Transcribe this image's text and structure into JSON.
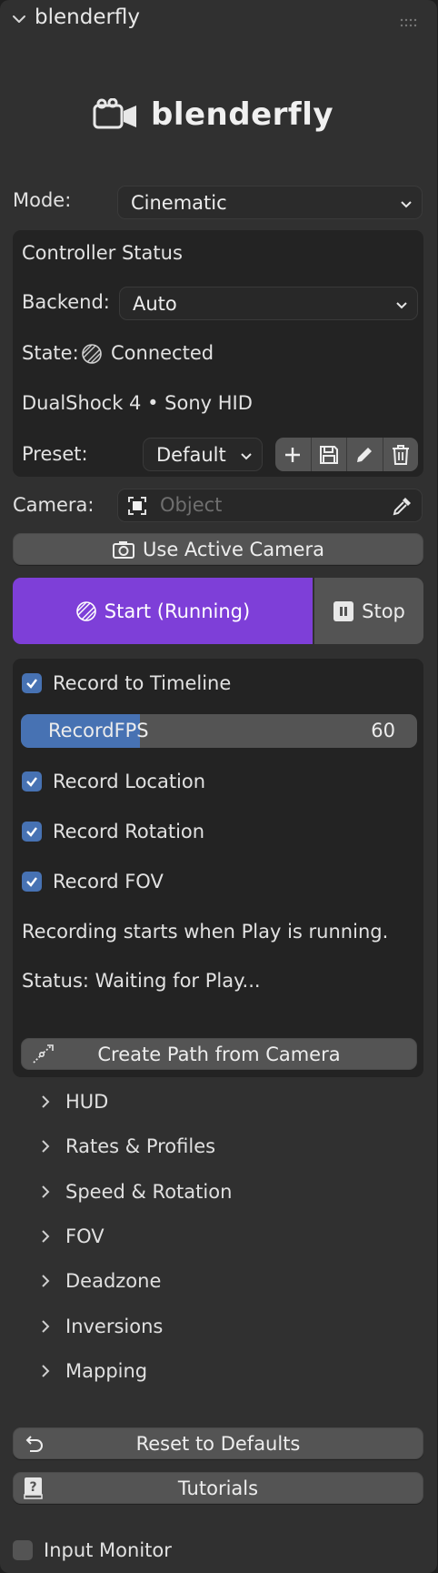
{
  "panel": {
    "title": "blenderfly"
  },
  "logo": {
    "text": "blenderfly"
  },
  "mode": {
    "label": "Mode:",
    "value": "Cinematic"
  },
  "controller": {
    "heading": "Controller Status",
    "backend_label": "Backend:",
    "backend_value": "Auto",
    "state_label": "State:",
    "state_value": "Connected",
    "device": "DualShock 4 • Sony HID",
    "preset_label": "Preset:",
    "preset_value": "Default"
  },
  "camera": {
    "label": "Camera:",
    "placeholder": "Object"
  },
  "use_active_camera": {
    "label": "Use Active Camera"
  },
  "start_button": {
    "label": "Start (Running)",
    "color": "#7e3fd8"
  },
  "stop_button": {
    "label": "Stop"
  },
  "recording": {
    "record_to_timeline": "Record to Timeline",
    "fps_label_left": "Record",
    "fps_label_right": "FPS",
    "fps_value": "60",
    "fps_fill_fraction": 0.3,
    "record_location": "Record Location",
    "record_rotation": "Record Rotation",
    "record_fov": "Record FOV",
    "info": "Recording starts when Play is running.",
    "status": "Status: Waiting for Play...",
    "create_path": "Create Path from Camera"
  },
  "sections": [
    "HUD",
    "Rates & Profiles",
    "Speed & Rotation",
    "FOV",
    "Deadzone",
    "Inversions",
    "Mapping"
  ],
  "reset_button": {
    "label": "Reset to Defaults"
  },
  "tutorials_button": {
    "label": "Tutorials"
  },
  "input_monitor": {
    "label": "Input Monitor"
  },
  "colors": {
    "accent": "#4772b3",
    "panel_bg": "#303030",
    "box_bg": "#232323",
    "button_bg": "#545454"
  }
}
